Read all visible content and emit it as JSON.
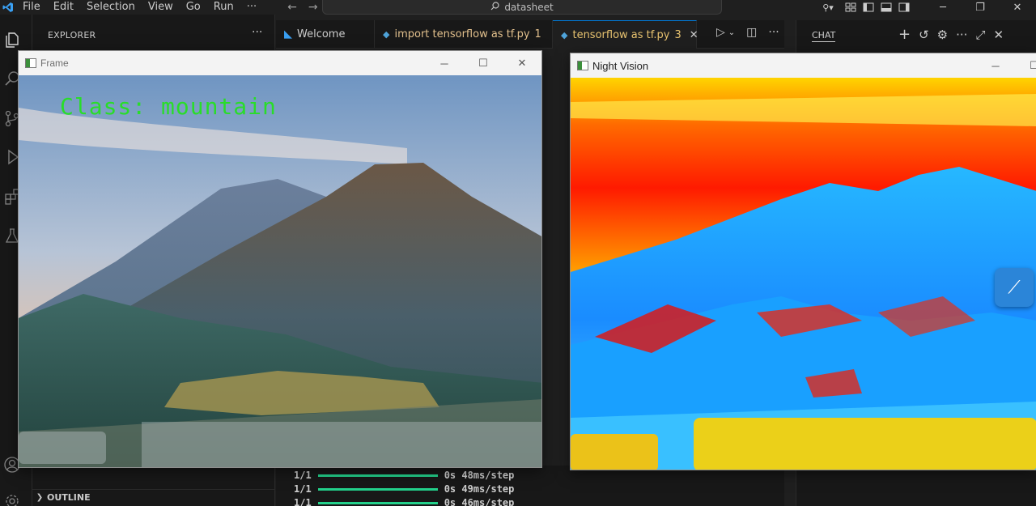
{
  "titlebar": {
    "menu": [
      "File",
      "Edit",
      "Selection",
      "View",
      "Go",
      "Run",
      "···"
    ],
    "search_text": "datasheet"
  },
  "sidebar": {
    "title": "EXPLORER",
    "outline_label": "OUTLINE"
  },
  "tabs": [
    {
      "label": "Welcome",
      "icon": "vscode-icon"
    },
    {
      "label": "import tensorflow as tf.py",
      "badge": "1",
      "icon": "python-icon"
    },
    {
      "label": "tensorflow as tf.py",
      "badge": "3",
      "icon": "python-icon",
      "active": true
    }
  ],
  "chat": {
    "title": "CHAT"
  },
  "terminal": {
    "rows": [
      {
        "step": "1/1",
        "time": "0s 48ms/step"
      },
      {
        "step": "1/1",
        "time": "0s 49ms/step"
      },
      {
        "step": "1/1",
        "time": "0s 46ms/step"
      }
    ],
    "progress_color": "#23d18b"
  },
  "frame_window": {
    "title": "Frame",
    "class_label": "Class: mountain",
    "label_color": "#29dd29"
  },
  "night_window": {
    "title": "Night Vision"
  },
  "colors": {
    "accent": "#0078d4",
    "tab_warning": "#e7c26f",
    "background": "#1f1f1f"
  }
}
